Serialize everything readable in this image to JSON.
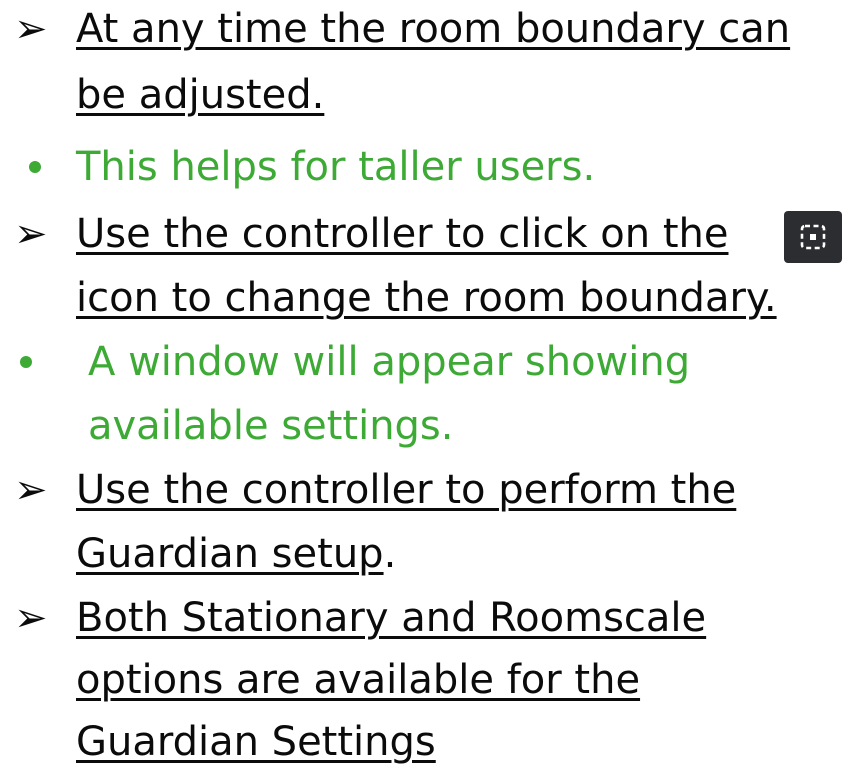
{
  "bullets": {
    "b1_line1": "At any time the room boundary can",
    "b1_line2": "be adjusted.",
    "g1": "This helps for taller users.",
    "b2_line1": "Use the controller to click on the",
    "b2_line2": "icon to change the room boundary.",
    "g2_line1": "A window will appear showing",
    "g2_line2": "available settings.",
    "b3_line1": "Use the controller to perform the ",
    "b3_line2": "Guardian setup",
    "b3_line2_suffix": ".",
    "b4_line1": "Both Stationary and Roomscale",
    "b4_line2": "options are available for the",
    "b4_line3": "Guardian Settings"
  },
  "arrow_glyph": "➢",
  "icon": {
    "name": "room-boundary-icon",
    "bg_color": "#2c2d30",
    "fg_color": "#ffffff"
  },
  "colors": {
    "text": "#0b0b0b",
    "green": "#3daa35"
  }
}
